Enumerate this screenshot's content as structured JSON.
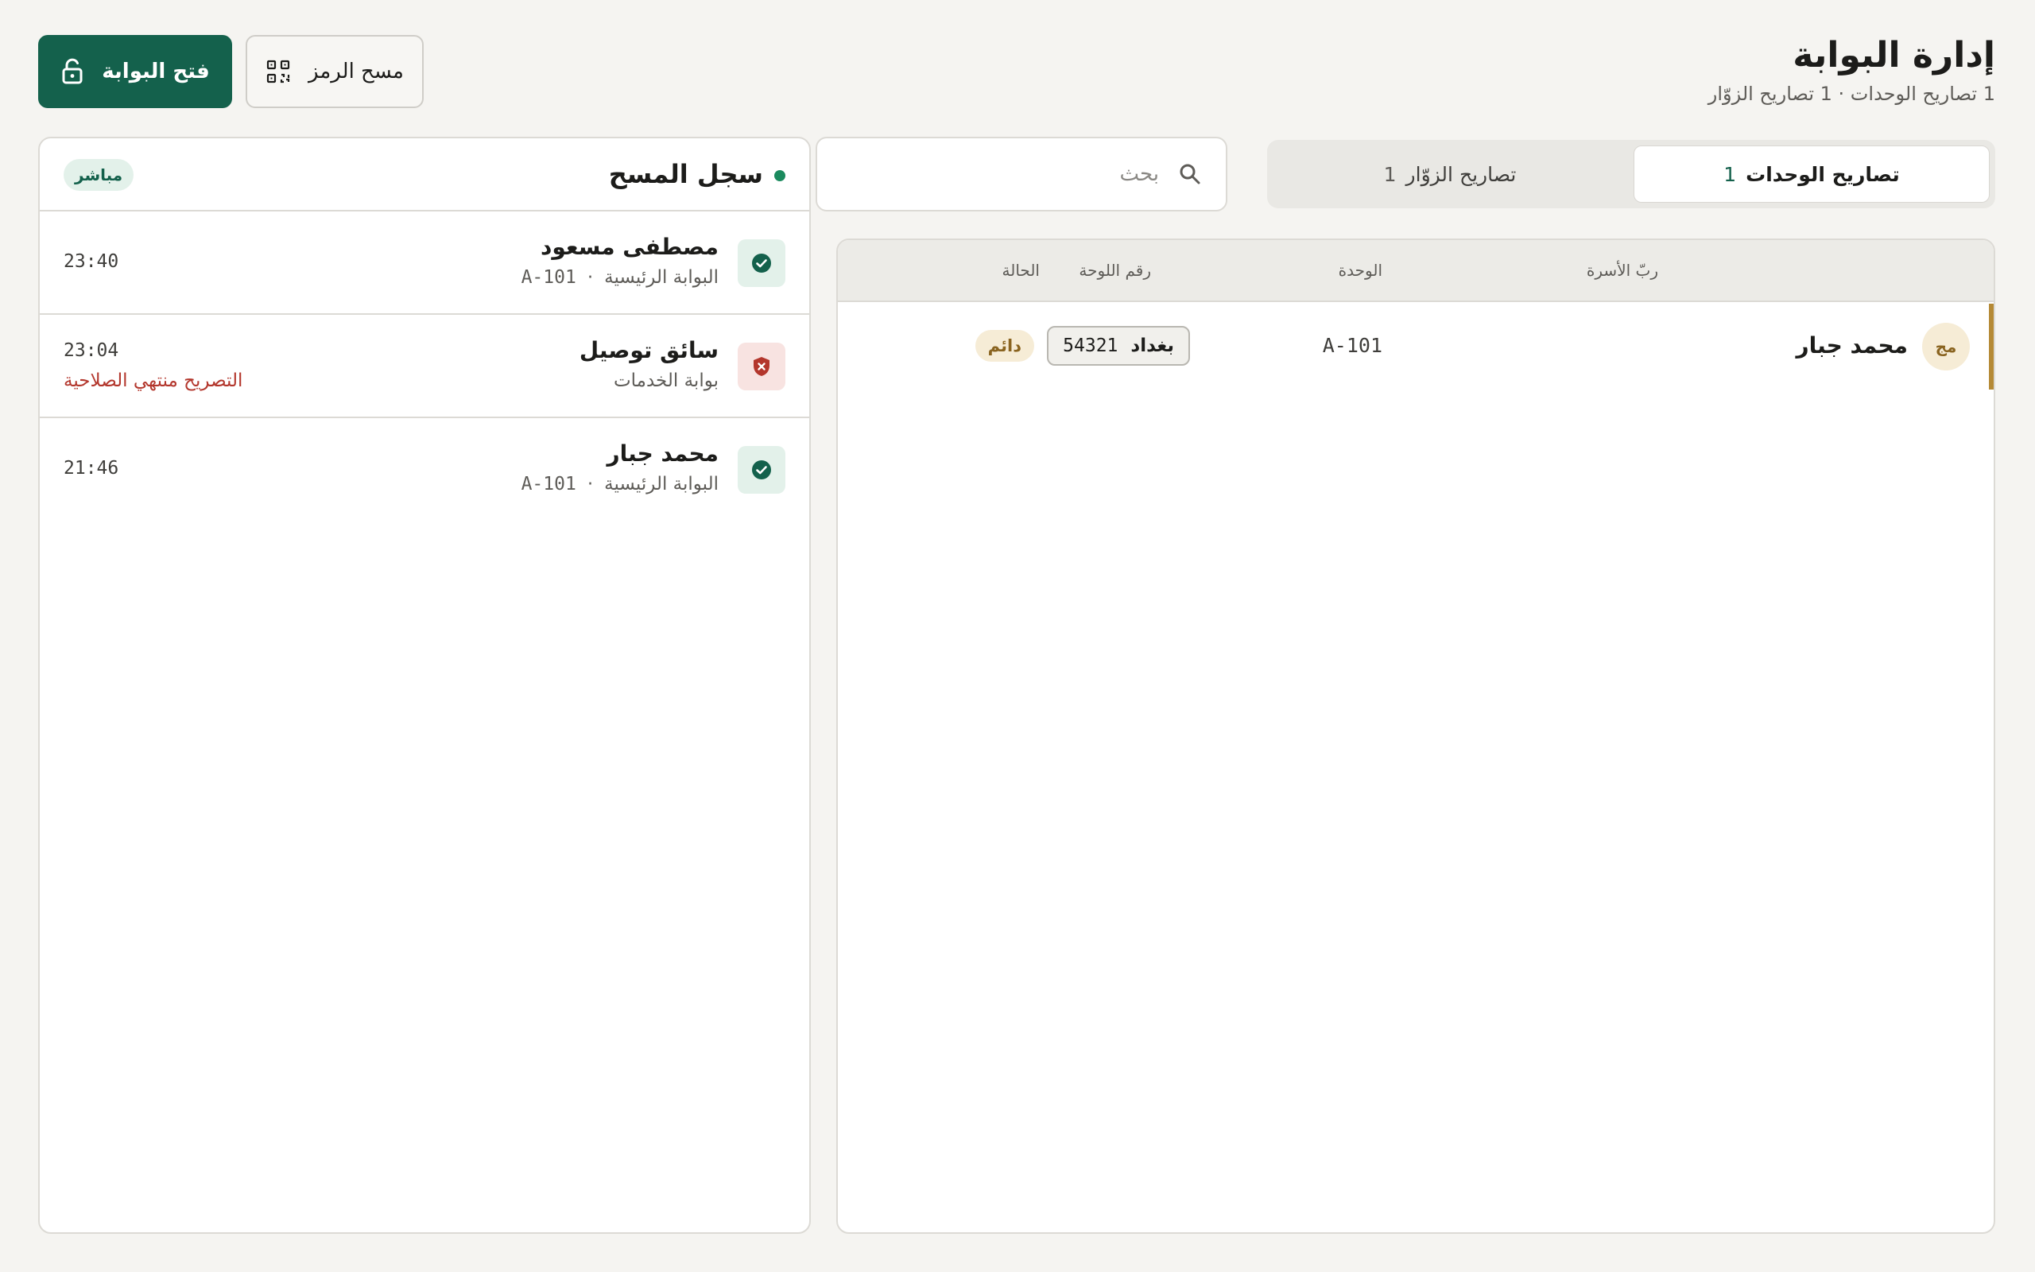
{
  "header": {
    "title": "إدارة البوابة",
    "subtitle": "1 تصاريح الوحدات · 1 تصاريح الزوّار",
    "open_gate_label": "فتح البوابة",
    "scan_code_label": "مسح الرمز"
  },
  "tabs": [
    {
      "label": "تصاريح الوحدات",
      "count": "1",
      "active": true
    },
    {
      "label": "تصاريح الزوّار",
      "count": "1",
      "active": false
    }
  ],
  "search": {
    "placeholder": "بحث",
    "value": ""
  },
  "table": {
    "columns": [
      "ربّ الأسرة",
      "الوحدة",
      "رقم اللوحة",
      "الحالة"
    ],
    "rows": [
      {
        "initials": "مج",
        "name": "محمد جبار",
        "unit": "A-101",
        "plate_city": "بغداد",
        "plate_number": "54321",
        "status": "دائم"
      }
    ]
  },
  "scan_log": {
    "title": "سجل المسح",
    "live_label": "مباشر",
    "entries": [
      {
        "name": "مصطفى مسعود",
        "gate": "البوابة الرئيسية",
        "unit": "A-101",
        "time": "23:40",
        "result": "allowed",
        "error": ""
      },
      {
        "name": "سائق توصيل",
        "gate": "بوابة الخدمات",
        "unit": "",
        "time": "23:04",
        "result": "denied",
        "error": "التصريح منتهي الصلاحية"
      },
      {
        "name": "محمد جبار",
        "gate": "البوابة الرئيسية",
        "unit": "A-101",
        "time": "21:46",
        "result": "allowed",
        "error": ""
      }
    ]
  },
  "colors": {
    "primary": "#14614c",
    "accent_gold": "#b58a36",
    "error": "#b3362c",
    "background": "#f5f4f1"
  },
  "icons": {
    "open_gate": "unlock-icon",
    "scan_code": "qr-scan-icon",
    "search": "search-icon",
    "allowed": "check-circle-icon",
    "denied": "shield-x-icon"
  }
}
